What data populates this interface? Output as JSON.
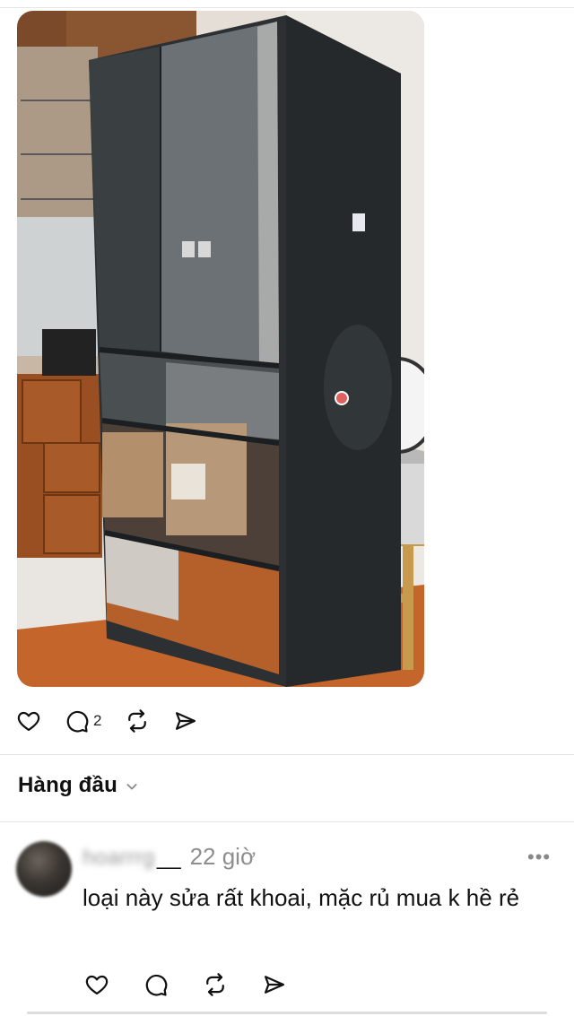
{
  "post": {
    "actions": {
      "like_icon": "heart-icon",
      "comment_icon": "comment-icon",
      "comment_count": "2",
      "repost_icon": "repost-icon",
      "share_icon": "send-icon"
    }
  },
  "sort": {
    "label": "Hàng đầu",
    "icon": "chevron-down-icon"
  },
  "comment": {
    "username": "hoarrrg",
    "username_suffix": "__",
    "time": "22 giờ",
    "more": "•••",
    "text": "loại này sửa rất khoai, mặc rủ mua k hề rẻ"
  },
  "colors": {
    "divider": "#e6e6e6",
    "muted": "#8e8e8e",
    "text": "#111111"
  }
}
